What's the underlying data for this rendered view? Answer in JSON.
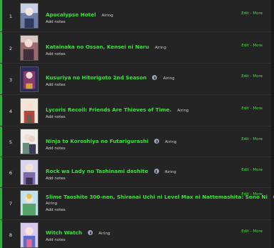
{
  "anime_list": [
    {
      "number": "1",
      "title": "Apocalypse Hotel",
      "status": "Airing",
      "notes_label": "Add notes",
      "edit_label": "Edit",
      "sep": "-",
      "more_label": "More",
      "poster_colors": [
        "#c7d0e6",
        "#6d7fa8",
        "#2f3b5c"
      ]
    },
    {
      "number": "2",
      "title": "Katainaka no Ossan, Kensei ni Naru",
      "status": "Airing",
      "notes_label": "Add notes",
      "edit_label": "Edit",
      "sep": "-",
      "more_label": "More",
      "poster_colors": [
        "#d9c8c2",
        "#9a6a72",
        "#3d2f3b"
      ]
    },
    {
      "number": "3",
      "title": "Kusuriya no Hitorigoto 2nd Season",
      "status": "Airing",
      "notes_label": "Add notes",
      "edit_label": "Edit",
      "sep": "-",
      "more_label": "More",
      "poster_colors": [
        "#2a2c5e",
        "#8a3a6a",
        "#d7a13a"
      ]
    },
    {
      "number": "4",
      "title": "Lycoris Recoil: Friends Are Thieves of Time.",
      "status": "Airing",
      "notes_label": "Add notes",
      "edit_label": "Edit",
      "sep": "-",
      "more_label": "More",
      "poster_colors": [
        "#f0e6da",
        "#b7463e",
        "#6f5a4c"
      ]
    },
    {
      "number": "5",
      "title": "Ninja to Koroshiya no Futarigurashi",
      "status": "Airing",
      "notes_label": "Add notes",
      "edit_label": "Edit",
      "sep": "-",
      "more_label": "More",
      "poster_colors": [
        "#f1eee9",
        "#6a8c7e",
        "#3b3b55"
      ]
    },
    {
      "number": "6",
      "title": "Rock wa Lady no Tashinami deshite",
      "status": "Airing",
      "notes_label": "Add notes",
      "edit_label": "Edit",
      "sep": "-",
      "more_label": "More",
      "poster_colors": [
        "#d8d6ee",
        "#7e6aa8",
        "#3a2e52"
      ]
    },
    {
      "number": "7",
      "title": "Slime Taoshite 300-nen, Shiranai Uchi ni Level Max ni Nattemashita: Sono Ni",
      "status": "Airing",
      "notes_label": "Add notes",
      "edit_label": "Edit",
      "sep": "-",
      "more_label": "More",
      "poster_colors": [
        "#bfe3ee",
        "#58a36a",
        "#e7c04a"
      ]
    },
    {
      "number": "8",
      "title": "Witch Watch",
      "status": "Airing",
      "notes_label": "Add notes",
      "edit_label": "Edit",
      "sep": "-",
      "more_label": "More",
      "poster_colors": [
        "#d6c8ee",
        "#5a6cc8",
        "#e86a9a"
      ]
    }
  ],
  "colors": {
    "accent_green": "#34e634",
    "status_bar_green": "#2db039",
    "row_background": "#242424",
    "page_background": "#1b1b1b"
  },
  "icons": {
    "status_icon": "airing-status-icon"
  }
}
